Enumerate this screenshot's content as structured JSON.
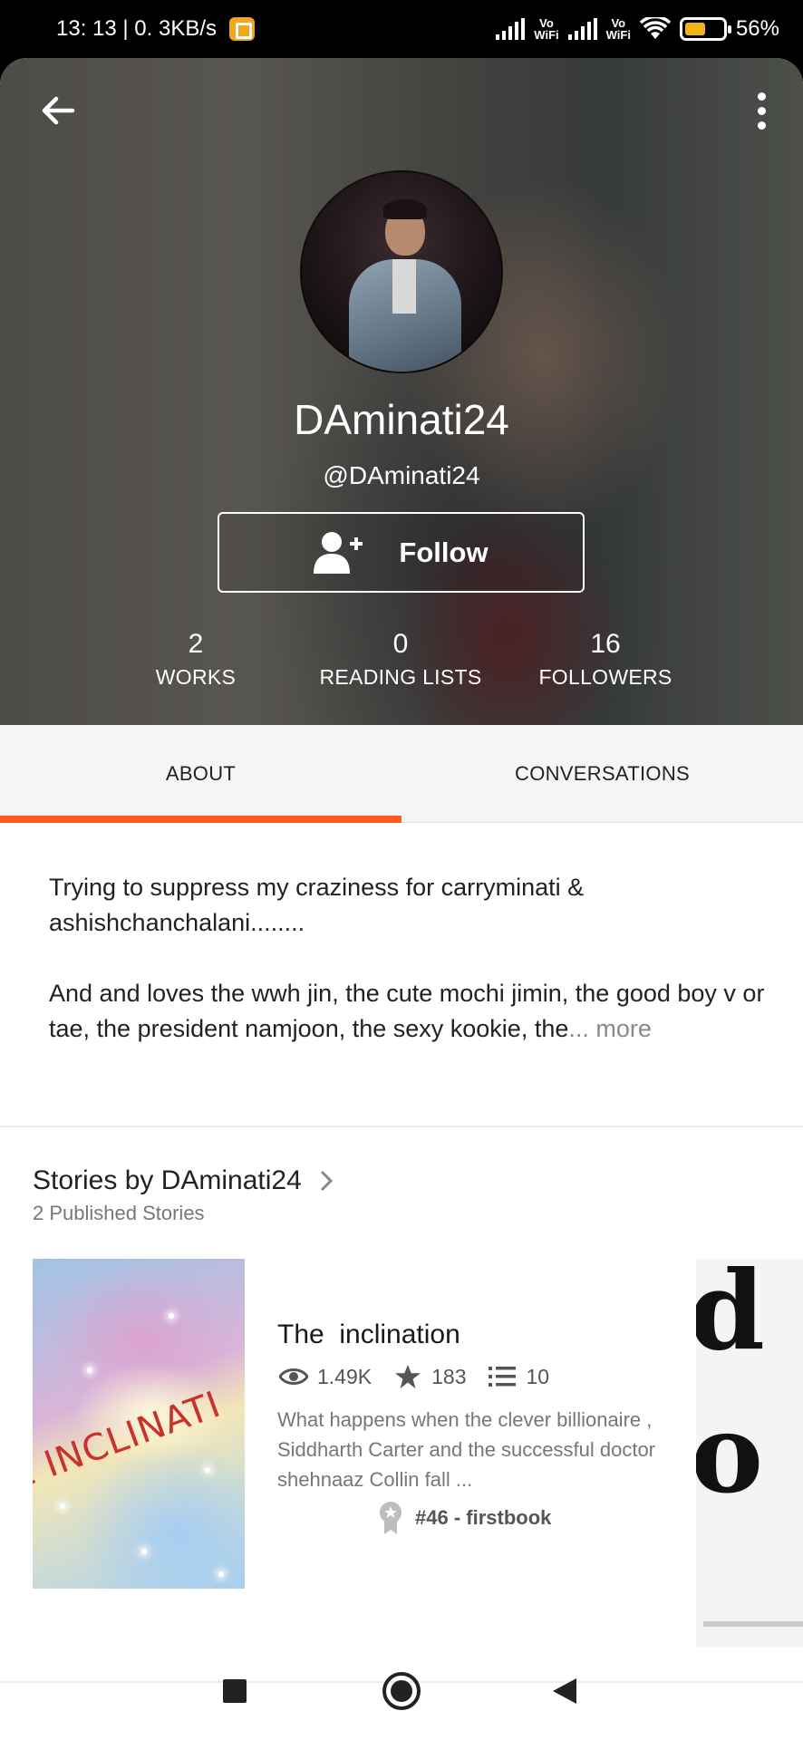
{
  "status_bar": {
    "time_speed": "13: 13 | 0. 3KB/s",
    "volte1": "Vo\nWiFi",
    "volte2": "Vo\nWiFi",
    "battery": "56%"
  },
  "header": {
    "display_name": "DAminati24",
    "handle": "@DAminati24",
    "follow_label": "Follow",
    "stats": [
      {
        "value": "2",
        "label": "WORKS"
      },
      {
        "value": "0",
        "label": "READING LISTS"
      },
      {
        "value": "16",
        "label": "FOLLOWERS"
      }
    ]
  },
  "tabs": [
    {
      "label": "ABOUT",
      "active": true
    },
    {
      "label": "CONVERSATIONS",
      "active": false
    }
  ],
  "about": {
    "para1": "Trying to suppress my craziness for carryminati & ashishchanchalani........",
    "para2": "And and loves the wwh jin, the cute mochi jimin, the good boy v or tae, the president namjoon, the sexy kookie, the",
    "more": "... more"
  },
  "stories": {
    "title": "Stories by DAminati24",
    "subtitle": "2 Published Stories",
    "items": [
      {
        "title": "The  inclination",
        "cover_text": "E INCLINATI",
        "reads": "1.49K",
        "votes": "183",
        "parts": "10",
        "description": "What happens when the clever billionaire , Siddharth Carter and the successful doctor shehnaaz Collin fall ...",
        "rank": "#46 - firstbook"
      }
    ]
  },
  "colors": {
    "accent": "#ff5a1f",
    "text": "#222222",
    "muted": "#777777"
  },
  "icons": [
    "back-arrow-icon",
    "more-vertical-icon",
    "add-person-icon",
    "eye-icon",
    "star-icon",
    "list-icon",
    "rank-badge-icon",
    "chevron-right-icon",
    "nav-recents-icon",
    "nav-home-icon",
    "nav-back-icon"
  ]
}
